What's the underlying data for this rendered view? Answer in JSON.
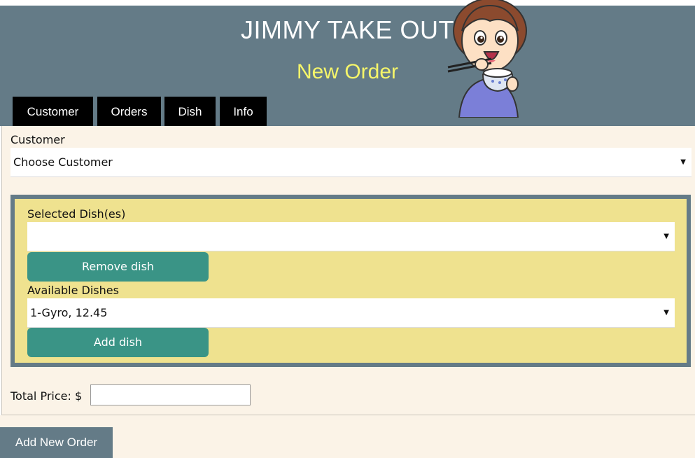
{
  "header": {
    "title": "JIMMY TAKE OUT",
    "subtitle": "New Order",
    "mascot_icon": "mascot-eating-rice"
  },
  "nav": {
    "tabs": [
      {
        "label": "Customer"
      },
      {
        "label": "Orders"
      },
      {
        "label": "Dish"
      },
      {
        "label": "Info"
      }
    ]
  },
  "form": {
    "customer_label": "Customer",
    "customer_select_value": "Choose Customer",
    "selected_dishes_label": "Selected Dish(es)",
    "selected_dishes_value": "",
    "remove_button": "Remove dish",
    "available_dishes_label": "Available Dishes",
    "available_dishes_value": "1-Gyro, 12.45",
    "add_button": "Add dish",
    "total_price_label": "Total Price: $",
    "total_price_value": ""
  },
  "footer": {
    "add_order_button": "Add New Order"
  },
  "colors": {
    "header_bg": "#647b87",
    "subtitle": "#f5f56a",
    "panel_bg": "#fbf3e7",
    "dish_box_bg": "#efe28f",
    "button_teal": "#3a9486"
  }
}
